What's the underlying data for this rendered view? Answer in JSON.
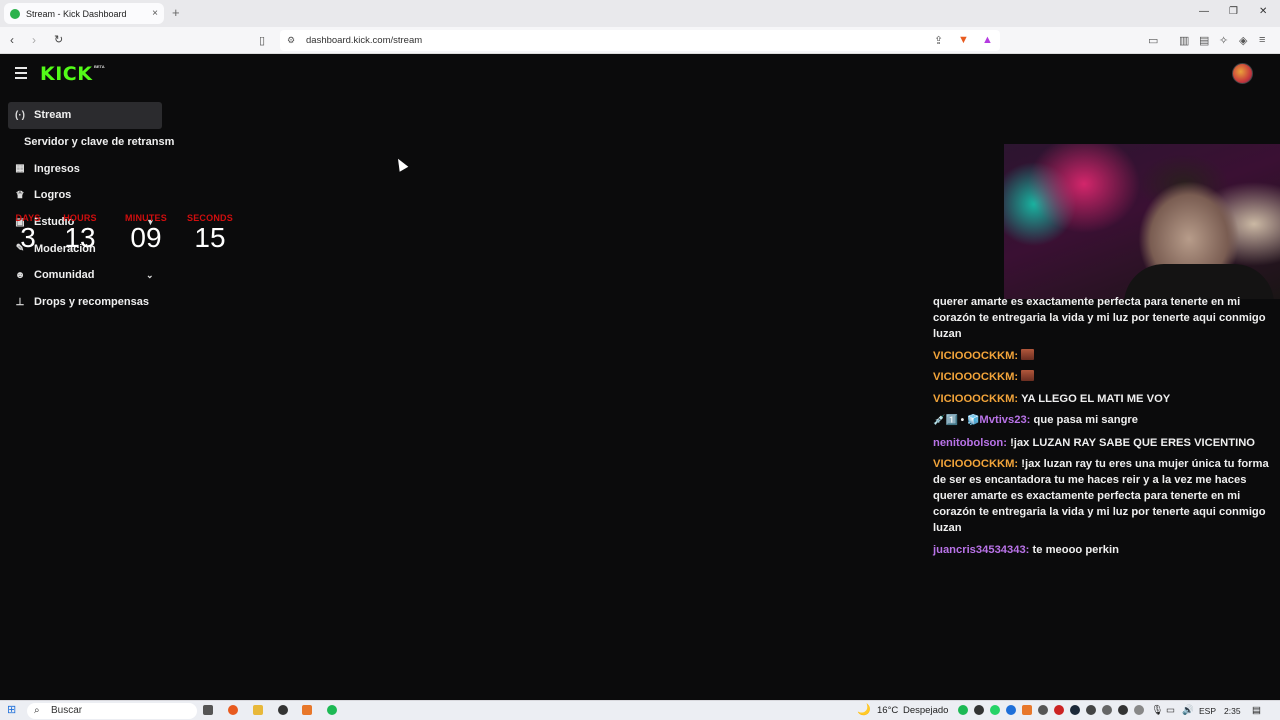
{
  "browser": {
    "tab_title": "Stream - Kick Dashboard",
    "tab_close": "×",
    "new_tab": "+",
    "url": "dashboard.kick.com/stream",
    "window_minimize": "—",
    "window_maximize": "❐",
    "window_close": "✕"
  },
  "header": {
    "logo": "KICK",
    "beta": "BETA"
  },
  "sidebar": {
    "items": [
      {
        "label": "Stream",
        "icon": "broadcast-icon"
      },
      {
        "label": "Servidor y clave de retransm",
        "icon": ""
      },
      {
        "label": "Ingresos",
        "icon": "chart-icon"
      },
      {
        "label": "Logros",
        "icon": "trophy-icon"
      },
      {
        "label": "Estudio",
        "icon": "studio-icon"
      },
      {
        "label": "Moderación",
        "icon": "wrench-icon"
      },
      {
        "label": "Comunidad",
        "icon": "community-icon"
      },
      {
        "label": "Drops y recompensas",
        "icon": "drops-icon"
      }
    ]
  },
  "countdown": {
    "days_label": "DAYS",
    "hours_label": "HOURS",
    "minutes_label": "MINUTES",
    "seconds_label": "SECONDS",
    "days": "3",
    "hours": "13",
    "minutes": "09",
    "seconds": "15",
    "label_color": "#d00e0e"
  },
  "chat": {
    "messages": [
      {
        "user": "",
        "text": "querer amarte es exactamente perfecta para tenerte en mi corazón te entregaria la vida y mi luz por tenerte aqui conmigo luzan"
      },
      {
        "user": "VICIOOOCKKM:",
        "text": ""
      },
      {
        "user": "VICIOOOCKKM:",
        "text": ""
      },
      {
        "user": "VICIOOOCKKM:",
        "text": "YA LLEGO EL MATI ME VOY"
      },
      {
        "user": "Mvtivs23:",
        "text": "que pasa mi sangre"
      },
      {
        "user": "nenitobolson:",
        "text": "!jax LUZAN RAY SABE QUE ERES VICENTINO"
      },
      {
        "user": "VICIOOOCKKM:",
        "text": "!jax luzan ray tu eres una mujer única tu forma de ser es encantadora tu me haces reir y a la vez me haces querer amarte es exactamente perfecta para tenerte en mi corazón te entregaria la vida y mi luz por tenerte aqui conmigo luzan"
      },
      {
        "user": "juancris34534343:",
        "text": "te meooo perkin"
      }
    ],
    "badge_emoji": "💉1️⃣ • 🧊",
    "user_color_orange": "#f2a43a",
    "user_color_purple": "#b973e8"
  },
  "taskbar": {
    "search_placeholder": "Buscar",
    "weather_temp": "16°C",
    "weather_text": "Despejado",
    "lang": "ESP",
    "time": "2:35"
  }
}
